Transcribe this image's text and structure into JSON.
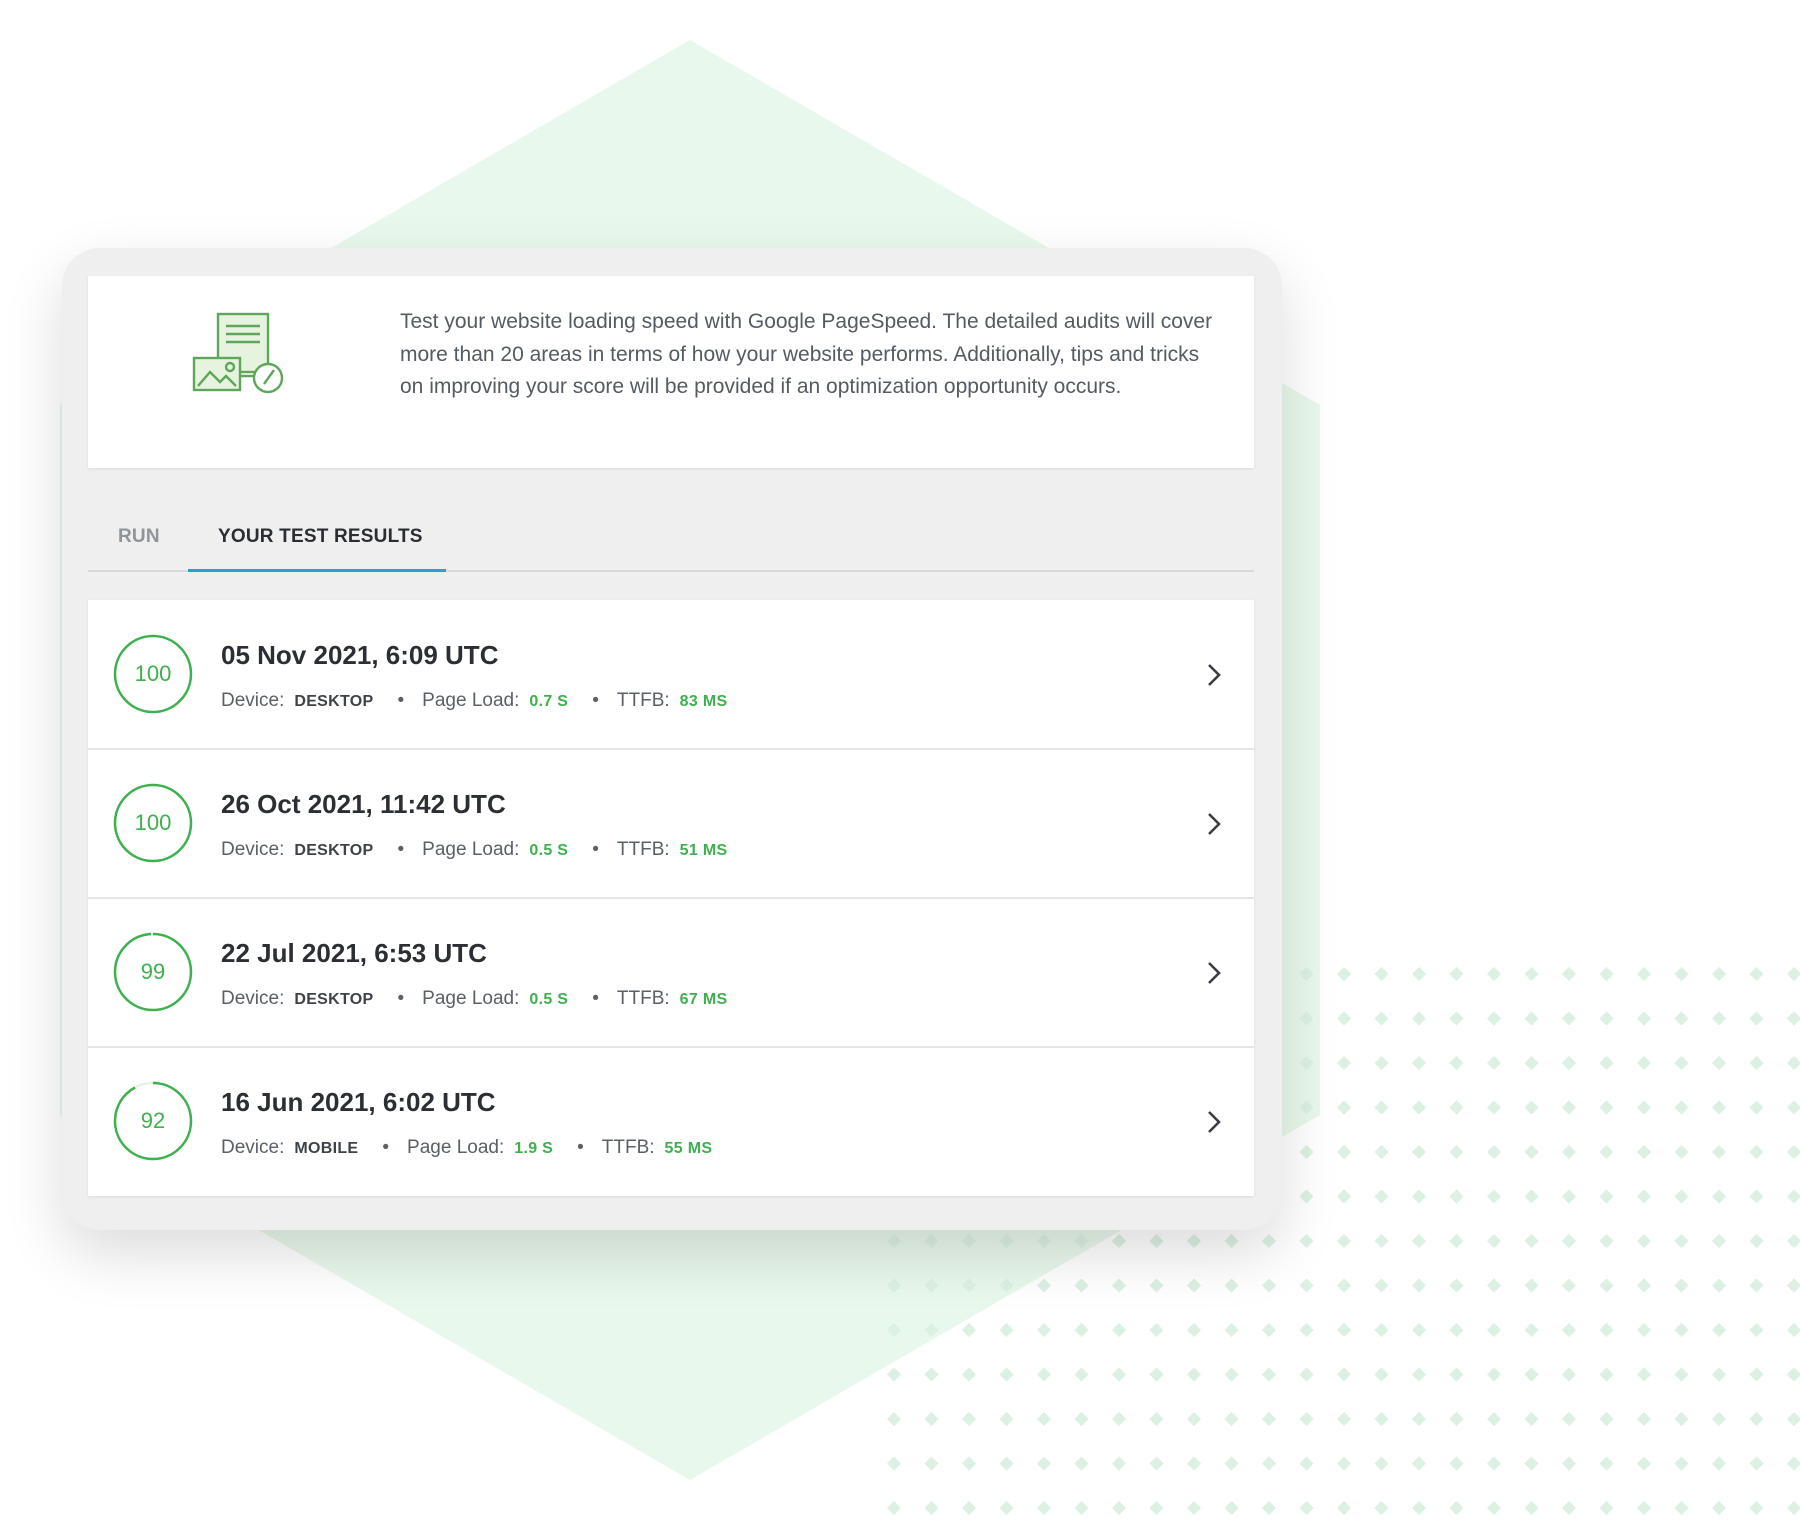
{
  "description": "Test your website loading speed with Google PageSpeed. The detailed audits will cover more than 20 areas in terms of how your website performs. Additionally, tips and tricks on improving your score will be provided if an optimization opportunity occurs.",
  "tabs": {
    "run": "RUN",
    "results": "YOUR TEST RESULTS"
  },
  "labels": {
    "device": "Device:",
    "page_load": "Page Load:",
    "ttfb": "TTFB:"
  },
  "results": [
    {
      "score": 100,
      "date": "05 Nov 2021, 6:09 UTC",
      "device": "DESKTOP",
      "page_load": "0.7 S",
      "ttfb": "83 MS"
    },
    {
      "score": 100,
      "date": "26 Oct 2021, 11:42 UTC",
      "device": "DESKTOP",
      "page_load": "0.5 S",
      "ttfb": "51 MS"
    },
    {
      "score": 99,
      "date": "22 Jul 2021, 6:53 UTC",
      "device": "DESKTOP",
      "page_load": "0.5 S",
      "ttfb": "67 MS"
    },
    {
      "score": 92,
      "date": "16 Jun 2021, 6:02 UTC",
      "device": "MOBILE",
      "page_load": "1.9 S",
      "ttfb": "55 MS"
    }
  ],
  "colors": {
    "accent_green": "#3fb04f",
    "tab_underline": "#2a9fcf",
    "hex_background": "#e9f8ec",
    "dot_color": "#dcf1e3"
  }
}
